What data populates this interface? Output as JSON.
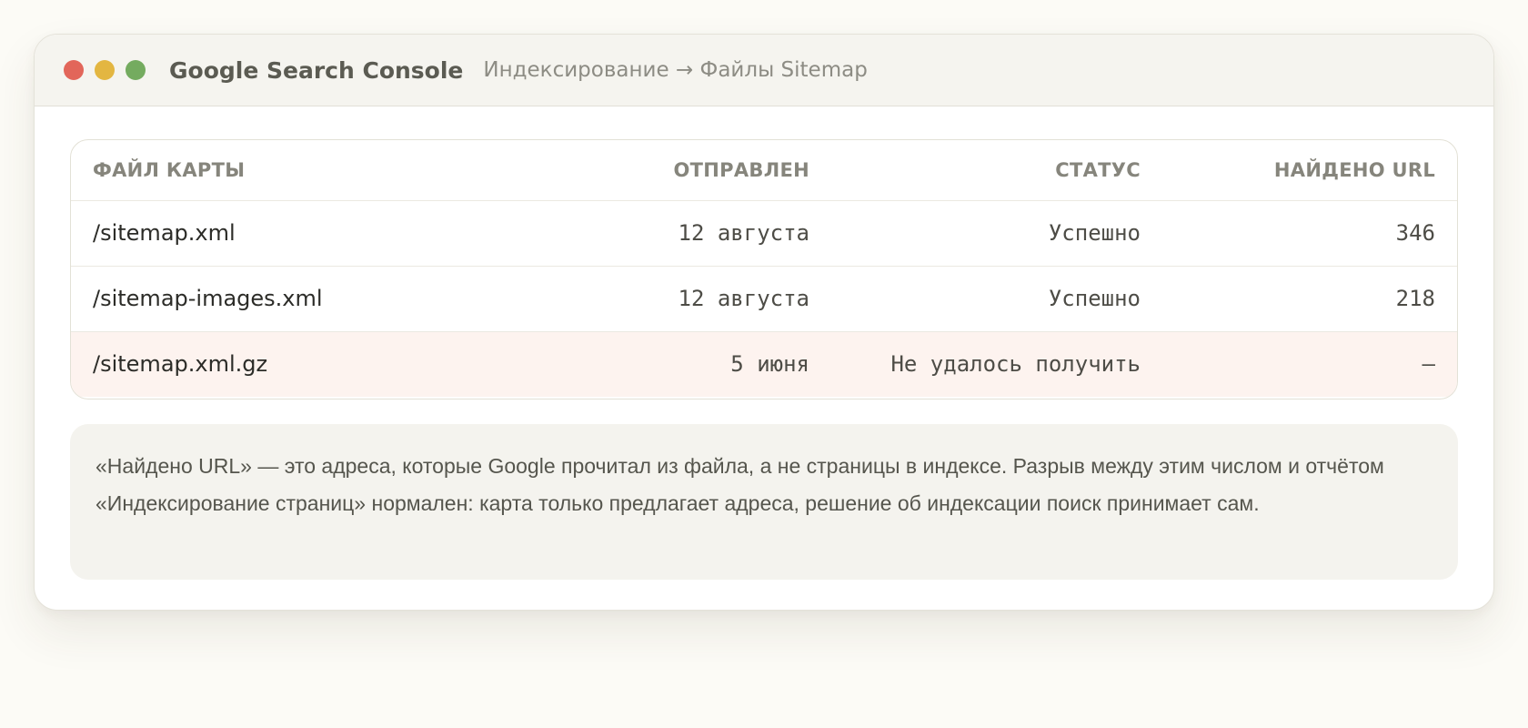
{
  "window": {
    "app_title": "Google Search Console",
    "breadcrumb": "Индексирование → Файлы Sitemap",
    "controls": {
      "close_color": "#e2665a",
      "minimize_color": "#e3b641",
      "maximize_color": "#74ab5f"
    }
  },
  "table": {
    "headers": {
      "file": "Файл карты",
      "sent": "Отправлен",
      "status": "Статус",
      "found": "Найдено URL"
    },
    "rows": [
      {
        "file": "/sitemap.xml",
        "sent": "12 августа",
        "status": "Успешно",
        "found": "346"
      },
      {
        "file": "/sitemap-images.xml",
        "sent": "12 августа",
        "status": "Успешно",
        "found": "218"
      },
      {
        "file": "/sitemap.xml.gz",
        "sent": "5 июня",
        "status": "Не удалось получить",
        "found": "—",
        "state": "error"
      }
    ]
  },
  "note": "«Найдено URL» — это адреса, которые Google прочитал из файла, а не страницы в индексе. Разрыв между этим числом и отчётом «Индексирование страниц» нормален: карта только предлагает адреса, решение об индексации поиск принимает сам.",
  "colors": {
    "error_row_bg": "#fdf3ef"
  }
}
